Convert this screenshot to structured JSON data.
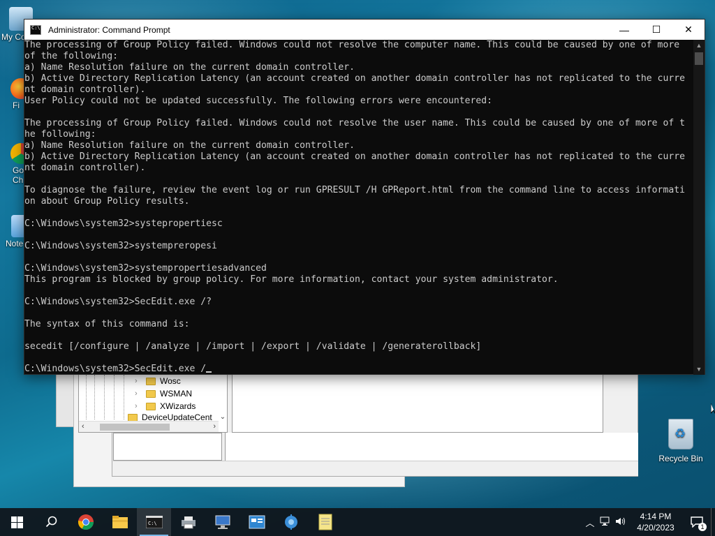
{
  "desktop": {
    "icons": [
      {
        "label": "My Co"
      },
      {
        "label": "Fi"
      },
      {
        "label": "Go\nCh"
      },
      {
        "label": "Note"
      }
    ],
    "recycle_bin": "Recycle Bin"
  },
  "explorer": {
    "tree_items": [
      "Wosc",
      "WSMAN",
      "XWizards",
      "DeviceUpdateCent"
    ]
  },
  "cmd": {
    "title": "Administrator: Command Prompt",
    "controls": {
      "minimize": "—",
      "maximize": "☐",
      "close": "✕"
    },
    "lines": [
      "The processing of Group Policy failed. Windows could not resolve the computer name. This could be caused by one of more",
      "of the following:",
      "a) Name Resolution failure on the current domain controller.",
      "b) Active Directory Replication Latency (an account created on another domain controller has not replicated to the curre",
      "nt domain controller).",
      "User Policy could not be updated successfully. The following errors were encountered:",
      "",
      "The processing of Group Policy failed. Windows could not resolve the user name. This could be caused by one of more of t",
      "he following:",
      "a) Name Resolution failure on the current domain controller.",
      "b) Active Directory Replication Latency (an account created on another domain controller has not replicated to the curre",
      "nt domain controller).",
      "",
      "To diagnose the failure, review the event log or run GPRESULT /H GPReport.html from the command line to access informati",
      "on about Group Policy results.",
      "",
      "C:\\Windows\\system32>systepropertiesc",
      "",
      "C:\\Windows\\system32>systempreropesi",
      "",
      "C:\\Windows\\system32>systempropertiesadvanced",
      "This program is blocked by group policy. For more information, contact your system administrator.",
      "",
      "C:\\Windows\\system32>SecEdit.exe /?",
      "",
      "The syntax of this command is:",
      "",
      "secedit [/configure | /analyze | /import | /export | /validate | /generaterollback]",
      "",
      "C:\\Windows\\system32>SecEdit.exe /"
    ]
  },
  "taskbar": {
    "items": [
      "start-icon",
      "search-icon",
      "chrome-icon",
      "file-explorer-icon",
      "command-prompt-icon",
      "printer-icon",
      "remote-desktop-icon",
      "control-panel-icon",
      "network-icon",
      "notepad-icon"
    ],
    "time": "4:14 PM",
    "date": "4/20/2023",
    "notification_count": "1"
  }
}
